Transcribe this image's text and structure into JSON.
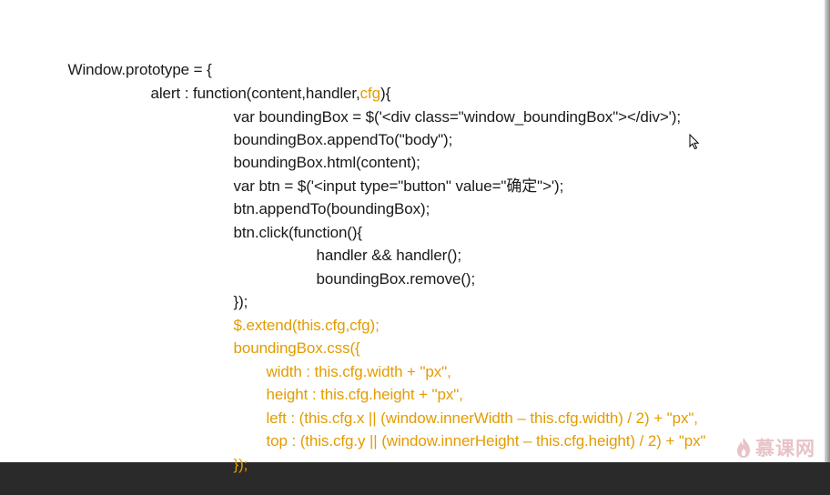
{
  "code": {
    "lines": [
      {
        "text": "Window.prototype = {"
      },
      {
        "text": "alert : function(content,handler,",
        "hl": "cfg",
        "after": "){"
      },
      {
        "text": "var boundingBox = $('<div class=\"window_boundingBox\"></div>');"
      },
      {
        "text": "boundingBox.appendTo(\"body\");"
      },
      {
        "text": "boundingBox.html(content);"
      },
      {
        "text": "var btn = $('<input type=\"button\" value=\"确定\">');"
      },
      {
        "text": "btn.appendTo(boundingBox);"
      },
      {
        "text": "btn.click(function(){"
      },
      {
        "text": "handler && handler();"
      },
      {
        "text": "boundingBox.remove();"
      },
      {
        "text": "});"
      },
      {
        "hl": "$.extend(this.cfg,cfg);"
      },
      {
        "hl": "boundingBox.css({"
      },
      {
        "hl": "width : this.cfg.width + \"px\","
      },
      {
        "hl": "height : this.cfg.height + \"px\","
      },
      {
        "hl": "left : (this.cfg.x || (window.innerWidth – this.cfg.width) / 2) + \"px\","
      },
      {
        "hl": "top : (this.cfg.y || (window.innerHeight – this.cfg.height) / 2) + \"px\""
      },
      {
        "hl": "});"
      }
    ],
    "highlight_color": "#e39c00",
    "text_color": "#1a1a1a"
  },
  "watermark": {
    "text": "慕课网",
    "icon": "flame-icon",
    "color": "#e8c3c8"
  },
  "pointer": {
    "icon": "mouse-cursor-icon"
  }
}
